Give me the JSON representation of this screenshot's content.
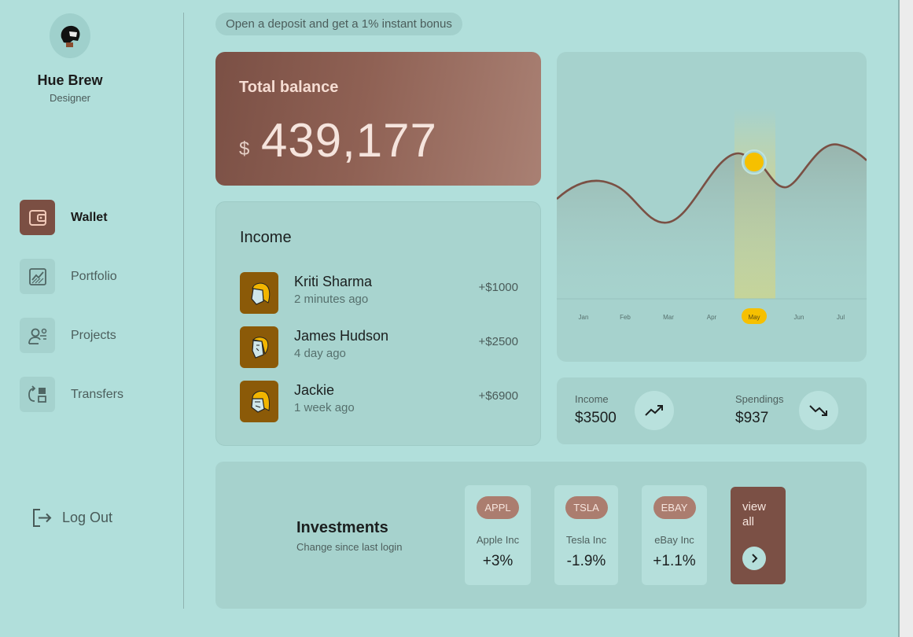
{
  "profile": {
    "name": "Hue Brew",
    "role": "Designer"
  },
  "nav": {
    "items": [
      {
        "label": "Wallet",
        "icon": "wallet-icon",
        "active": true
      },
      {
        "label": "Portfolio",
        "icon": "chart-icon",
        "active": false
      },
      {
        "label": "Projects",
        "icon": "projects-icon",
        "active": false
      },
      {
        "label": "Transfers",
        "icon": "transfers-icon",
        "active": false
      }
    ],
    "logout_label": "Log Out"
  },
  "banner": {
    "text": "Open a deposit and get a 1% instant bonus"
  },
  "balance": {
    "title": "Total balance",
    "currency": "$",
    "amount": "439,177"
  },
  "income": {
    "title": "Income",
    "rows": [
      {
        "name": "Kriti Sharma",
        "time": "2 minutes ago",
        "amount": "+$1000"
      },
      {
        "name": "James Hudson",
        "time": "4 day ago",
        "amount": "+$2500"
      },
      {
        "name": "Jackie",
        "time": "1 week ago",
        "amount": "+$6900"
      }
    ]
  },
  "chart_data": {
    "type": "line",
    "categories": [
      "Jan",
      "Feb",
      "Mar",
      "Apr",
      "May",
      "Jun",
      "Jul"
    ],
    "highlighted": "May",
    "line_color": "#7a5044",
    "marker_color": "#f6c000"
  },
  "stats": {
    "income": {
      "label": "Income",
      "value": "$3500",
      "icon": "trending-up-icon"
    },
    "spendings": {
      "label": "Spendings",
      "value": "$937",
      "icon": "trending-down-icon"
    }
  },
  "investments": {
    "title": "Investments",
    "subtitle": "Change since last login",
    "stocks": [
      {
        "ticker": "APPL",
        "name": "Apple Inc",
        "change": "+3%"
      },
      {
        "ticker": "TSLA",
        "name": "Tesla Inc",
        "change": "-1.9%"
      },
      {
        "ticker": "EBAY",
        "name": "eBay Inc",
        "change": "+1.1%"
      }
    ],
    "view_all_label": "view all"
  },
  "colors": {
    "background": "#b1dfdb",
    "accent_brown": "#7b5045",
    "marker_yellow": "#f6c000",
    "avatar_tile": "#8b5a08"
  }
}
